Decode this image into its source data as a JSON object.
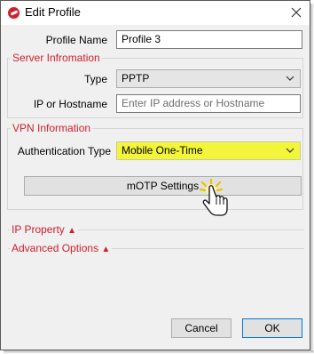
{
  "window": {
    "title": "Edit Profile",
    "close_icon": "close-icon",
    "app_icon": "forticlient-icon"
  },
  "profile_name": {
    "label": "Profile Name",
    "value": "Profile 3"
  },
  "server_information": {
    "title": "Server Infromation",
    "type_label": "Type",
    "type_value": "PPTP",
    "host_label": "IP or Hostname",
    "host_placeholder": "Enter IP address or Hostname"
  },
  "vpn_information": {
    "title": "VPN Information",
    "auth_label": "Authentication Type",
    "auth_value": "Mobile One-Time",
    "motp_button": "mOTP Settings"
  },
  "sections": {
    "ip_property": "IP Property",
    "advanced_options": "Advanced Options",
    "expand_glyph": "▲"
  },
  "footer": {
    "cancel": "Cancel",
    "ok": "OK"
  },
  "colors": {
    "accent_red": "#d0202e",
    "highlight_yellow": "#f2f53a"
  }
}
